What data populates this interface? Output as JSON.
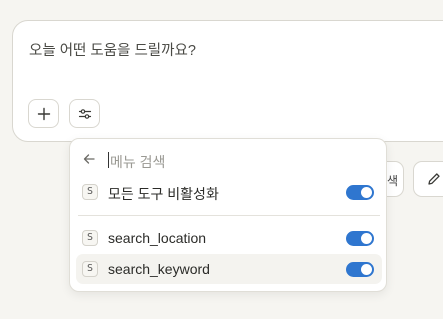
{
  "composer": {
    "placeholder": "오늘 어떤 도움을 드릴까요?",
    "add_icon": "plus-icon",
    "tools_icon": "sliders-icon"
  },
  "side_buttons": {
    "partial_text": "색",
    "edit_icon": "pencil-icon"
  },
  "menu": {
    "back_icon": "arrow-left-icon",
    "search_placeholder": "메뉴 검색",
    "items": [
      {
        "badge": "S",
        "label": "모든 도구 비활성화",
        "enabled": true
      },
      {
        "badge": "S",
        "label": "search_location",
        "enabled": true
      },
      {
        "badge": "S",
        "label": "search_keyword",
        "enabled": true
      }
    ]
  },
  "colors": {
    "background": "#f6f5f1",
    "toggle_on": "#2f76cf"
  }
}
